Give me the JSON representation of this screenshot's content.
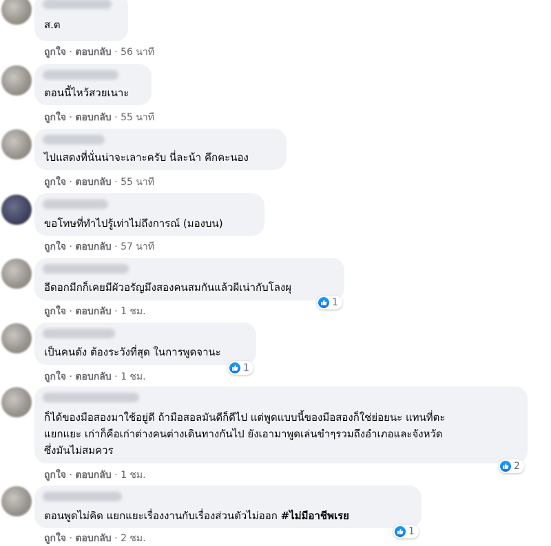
{
  "actions": {
    "like": "ถูกใจ",
    "reply": "ตอบกลับ",
    "separator": "·"
  },
  "comments": [
    {
      "text": "ส.ต",
      "time": "56 นาที"
    },
    {
      "text": "ตอนนี้ไหว้สวยเนาะ",
      "time": "55 นาที"
    },
    {
      "text": "ไปแสดงที่นั่นน่าจะเลาะครับ นี่ละน้า คึกคะนอง",
      "time": "55 นาที"
    },
    {
      "text": "ขอโทษที่ทำไปรู้เท่าไม่ถึงการณ์ (มองบน)",
      "time": "57 นาที"
    },
    {
      "text": "อีดอกมีกก็เคยมีผัวอรัญมึงสองคนสมกันแล้วผีเน่ากับโลงผุ",
      "time": "1 ชม.",
      "reactions": "1"
    },
    {
      "text": "เป็นคนดัง ต้องระวังที่สุด ในการพูดจานะ",
      "time": "1 ชม.",
      "reactions": "1"
    },
    {
      "lines": [
        "ก็ได้ของมือสองมาใช้อยู่ดี ถ้ามือสอลมันดีก็ดีไป แต่พูดแบบนี้ของมือสองก็ใช่ย่อยนะ แทนที่ตะ",
        "แยกแยะ เก่าก็คือเก่าต่างคนต่างเดินทางกันไป ยังเอามาพูดเล่นขำๆรวมถึงอำเภอและจังหวัด",
        "ซึ่งมันไม่สมควร"
      ],
      "time": "1 ชม.",
      "reactions": "2"
    },
    {
      "text": "ตอนพูดไม่คิด แยกแยะเรื่องงานกับเรื่องส่วนตัวไม่ออก",
      "hashtag": "#ไม่มีอาชีพเรย",
      "time": "2 ชม.",
      "reactions": "1"
    }
  ]
}
